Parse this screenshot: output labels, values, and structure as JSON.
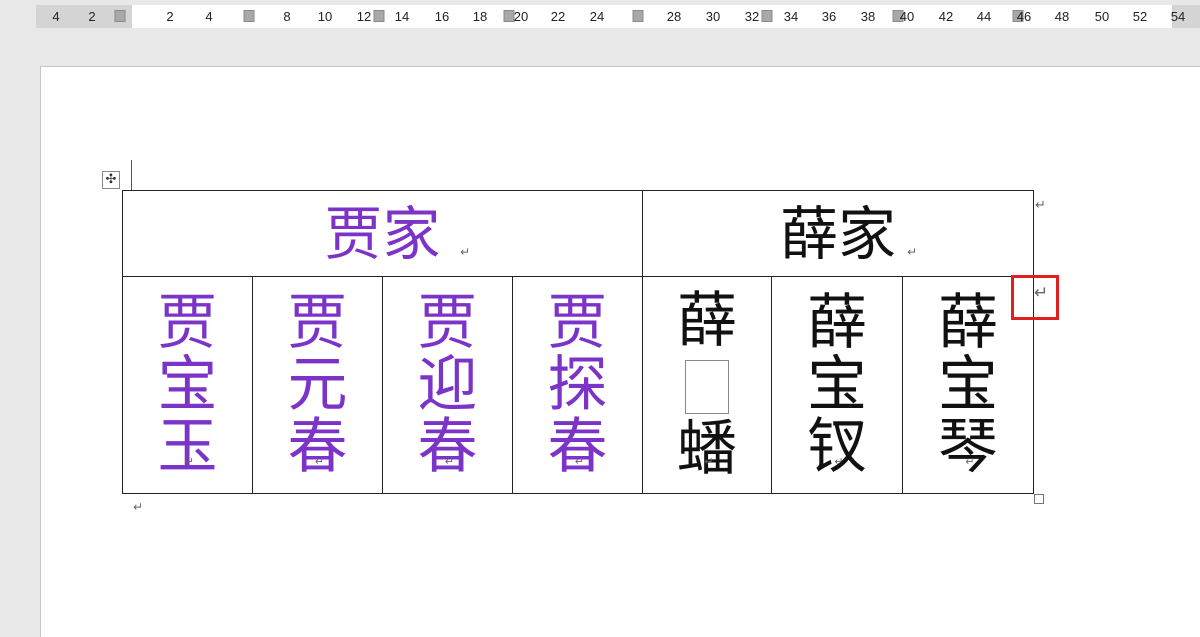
{
  "ruler": {
    "numbers": [
      "4",
      "2",
      "2",
      "4",
      "8",
      "10",
      "12",
      "14",
      "16",
      "18",
      "20",
      "22",
      "24",
      "28",
      "30",
      "32",
      "34",
      "36",
      "38",
      "40",
      "42",
      "44",
      "46",
      "48",
      "50",
      "52",
      "54"
    ]
  },
  "table": {
    "headers": [
      {
        "text": "贾家",
        "color": "#7b33c8"
      },
      {
        "text": "薛家",
        "color": "#111111"
      }
    ],
    "names": [
      {
        "text": "贾宝玉",
        "family": "jia"
      },
      {
        "text": "贾元春",
        "family": "jia"
      },
      {
        "text": "贾迎春",
        "family": "jia"
      },
      {
        "text": "贾探春",
        "family": "jia"
      },
      {
        "top": "薛",
        "bottom": "蟠",
        "family": "xue",
        "missing_glyph": true
      },
      {
        "text": "薛宝钗",
        "family": "xue"
      },
      {
        "text": "薛宝琴",
        "family": "xue"
      }
    ]
  },
  "icons": {
    "move_handle": "table-move-handle-icon",
    "paragraph_mark": "↵",
    "row_end_mark": "↵"
  },
  "colors": {
    "jia": "#7b33c8",
    "xue": "#111111",
    "highlight": "#e02020"
  }
}
